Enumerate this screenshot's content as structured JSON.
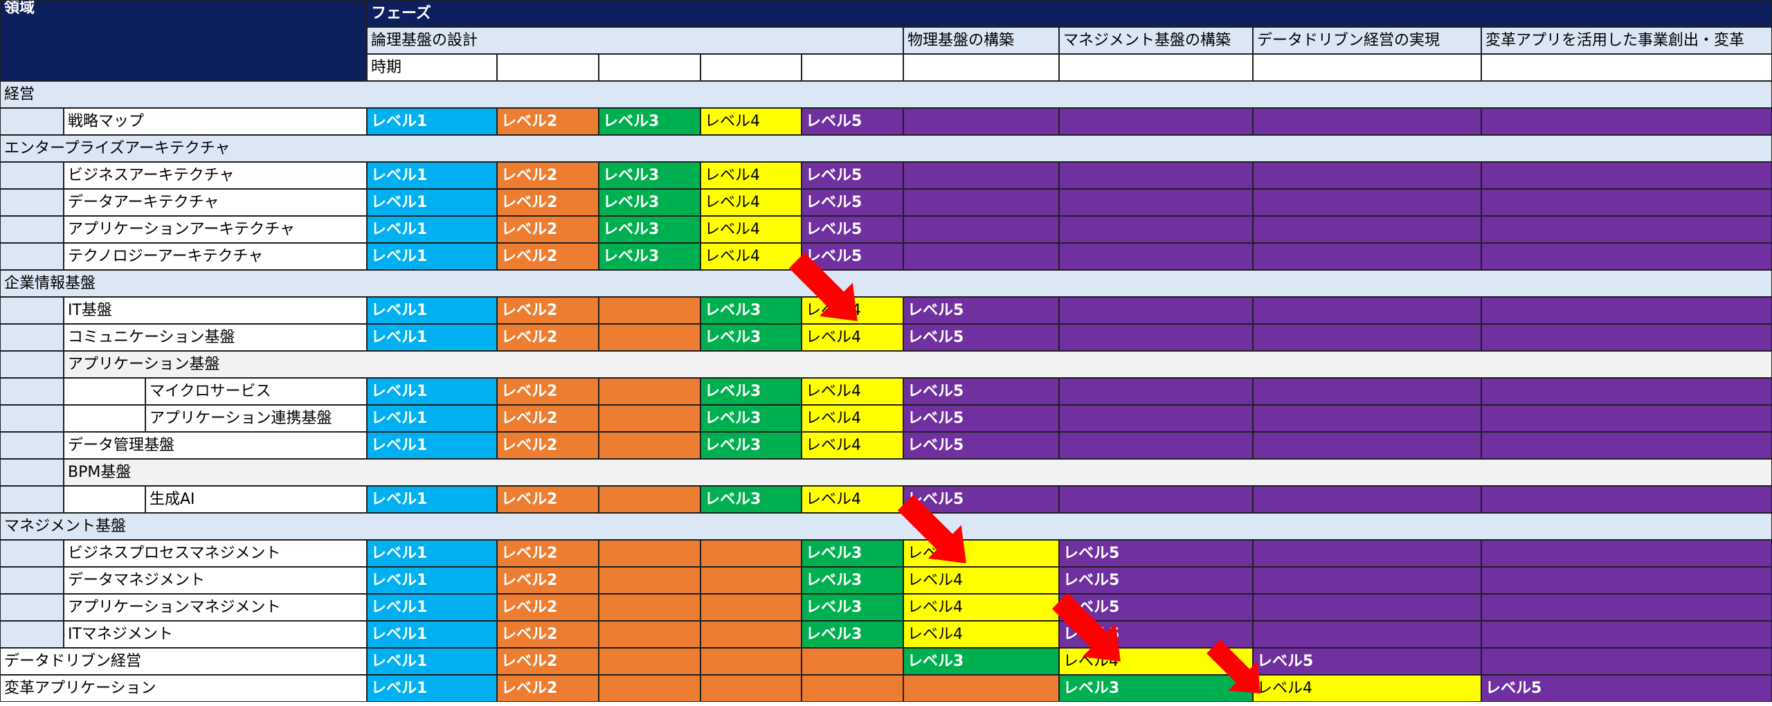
{
  "header": {
    "domain_label": "領域",
    "phase_label": "フェーズ",
    "phases": [
      "論理基盤の設計",
      "物理基盤の構築",
      "マネジメント基盤の構築",
      "データドリブン経営の実現",
      "変革アプリを活用した事業創出・変革"
    ],
    "time_label": "時期"
  },
  "colors": {
    "header_dark": "#0d1f5c",
    "header_light": "#dce7f6",
    "level_1": "#00b0f0",
    "orange": "#ed7d31",
    "level_3": "#00b050",
    "level_4": "#ffff00",
    "level_5": "#7030a0",
    "arrow": "#ff0000"
  },
  "levels": [
    "",
    "レベル1",
    "レベル2",
    "レベル3",
    "レベル4",
    "レベル5"
  ],
  "rows": [
    {
      "type": "section",
      "label": "経営"
    },
    {
      "type": "item",
      "indent": 1,
      "label": "戦略マップ",
      "cells": [
        1,
        2,
        3,
        4,
        5,
        "P",
        "P",
        "P",
        "P"
      ]
    },
    {
      "type": "section",
      "label": "エンタープライズアーキテクチャ"
    },
    {
      "type": "item",
      "indent": 1,
      "label": "ビジネスアーキテクチャ",
      "cells": [
        1,
        2,
        3,
        4,
        5,
        "P",
        "P",
        "P",
        "P"
      ]
    },
    {
      "type": "item",
      "indent": 1,
      "label": "データアーキテクチャ",
      "cells": [
        1,
        2,
        3,
        4,
        5,
        "P",
        "P",
        "P",
        "P"
      ]
    },
    {
      "type": "item",
      "indent": 1,
      "label": "アプリケーションアーキテクチャ",
      "cells": [
        1,
        2,
        3,
        4,
        5,
        "P",
        "P",
        "P",
        "P"
      ]
    },
    {
      "type": "item",
      "indent": 1,
      "label": "テクノロジーアーキテクチャ",
      "cells": [
        1,
        2,
        3,
        4,
        5,
        "P",
        "P",
        "P",
        "P"
      ]
    },
    {
      "type": "section",
      "label": "企業情報基盤"
    },
    {
      "type": "item",
      "indent": 1,
      "label": "IT基盤",
      "cells": [
        1,
        2,
        "O",
        3,
        4,
        5,
        "P",
        "P",
        "P"
      ]
    },
    {
      "type": "item",
      "indent": 1,
      "label": "コミュニケーション基盤",
      "cells": [
        1,
        2,
        "O",
        3,
        4,
        5,
        "P",
        "P",
        "P"
      ]
    },
    {
      "type": "subsection",
      "indent": 1,
      "label": "アプリケーション基盤"
    },
    {
      "type": "item",
      "indent": 2,
      "label": "マイクロサービス",
      "cells": [
        1,
        2,
        "O",
        3,
        4,
        5,
        "P",
        "P",
        "P"
      ]
    },
    {
      "type": "item",
      "indent": 2,
      "label": "アプリケーション連携基盤",
      "cells": [
        1,
        2,
        "O",
        3,
        4,
        5,
        "P",
        "P",
        "P"
      ]
    },
    {
      "type": "item",
      "indent": 1,
      "label": "データ管理基盤",
      "cells": [
        1,
        2,
        "O",
        3,
        4,
        5,
        "P",
        "P",
        "P"
      ]
    },
    {
      "type": "subsection",
      "indent": 1,
      "label": "BPM基盤"
    },
    {
      "type": "item",
      "indent": 2,
      "label": "生成AI",
      "cells": [
        1,
        2,
        "O",
        3,
        4,
        5,
        "P",
        "P",
        "P"
      ]
    },
    {
      "type": "section",
      "label": "マネジメント基盤"
    },
    {
      "type": "item",
      "indent": 1,
      "label": "ビジネスプロセスマネジメント",
      "cells": [
        1,
        2,
        "O",
        "O",
        3,
        4,
        5,
        "P",
        "P"
      ]
    },
    {
      "type": "item",
      "indent": 1,
      "label": "データマネジメント",
      "cells": [
        1,
        2,
        "O",
        "O",
        3,
        4,
        5,
        "P",
        "P"
      ]
    },
    {
      "type": "item",
      "indent": 1,
      "label": "アプリケーションマネジメント",
      "cells": [
        1,
        2,
        "O",
        "O",
        3,
        4,
        5,
        "P",
        "P"
      ]
    },
    {
      "type": "item",
      "indent": 1,
      "label": "ITマネジメント",
      "cells": [
        1,
        2,
        "O",
        "O",
        3,
        4,
        5,
        "P",
        "P"
      ]
    },
    {
      "type": "item",
      "indent": 0,
      "label": "データドリブン経営",
      "cells": [
        1,
        2,
        "O",
        "O",
        "O",
        3,
        4,
        5,
        "P"
      ]
    },
    {
      "type": "item",
      "indent": 0,
      "label": "変革アプリケーション",
      "cells": [
        1,
        2,
        "O",
        "O",
        "O",
        "O",
        3,
        4,
        5
      ]
    }
  ]
}
